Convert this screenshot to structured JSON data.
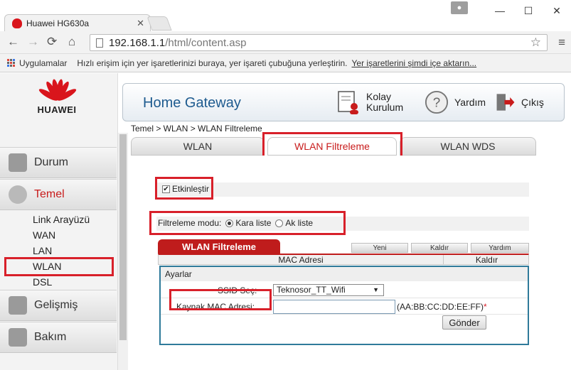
{
  "browser": {
    "tab_title": "Huawei HG630a",
    "url_host": "192.168.1.1",
    "url_path": "/html/content.asp",
    "bookmarks_apps": "Uygulamalar",
    "bookmarks_hint": "Hızlı erişim için yer işaretlerinizi buraya, yer işareti çubuğuna yerleştirin.",
    "bookmarks_import": "Yer işaretlerini şimdi içe aktarın..."
  },
  "logo": {
    "text": "HUAWEI"
  },
  "header": {
    "title": "Home Gateway",
    "quick_setup_line1": "Kolay",
    "quick_setup_line2": "Kurulum",
    "help": "Yardım",
    "logout": "Çıkış"
  },
  "breadcrumb": "Temel > WLAN > WLAN Filtreleme",
  "tabs": [
    {
      "label": "WLAN"
    },
    {
      "label": "WLAN Filtreleme"
    },
    {
      "label": "WLAN WDS"
    }
  ],
  "sidebar": {
    "sections": [
      {
        "label": "Durum"
      },
      {
        "label": "Temel"
      },
      {
        "label": "Gelişmiş"
      },
      {
        "label": "Bakım"
      }
    ],
    "subitems": [
      {
        "label": "Link Arayüzü"
      },
      {
        "label": "WAN"
      },
      {
        "label": "LAN"
      },
      {
        "label": "WLAN"
      },
      {
        "label": "DSL"
      }
    ]
  },
  "form": {
    "enable_label": "Etkinleştir",
    "filter_mode_label": "Filtreleme modu:",
    "blacklist": "Kara liste",
    "whitelist": "Ak liste",
    "panel_title": "WLAN Filtreleme",
    "btn_new": "Yeni",
    "btn_remove": "Kaldır",
    "btn_help": "Yardım",
    "col_mac": "MAC Adresi",
    "col_remove": "Kaldır",
    "settings_title": "Ayarlar",
    "ssid_label": "SSID Seç:",
    "ssid_value": "Teknosor_TT_Wifi",
    "mac_label": "Kaynak MAC Adresi:",
    "mac_value": "",
    "mac_hint": "(AA:BB:CC:DD:EE:FF)",
    "mac_required": "*",
    "submit": "Gönder"
  }
}
